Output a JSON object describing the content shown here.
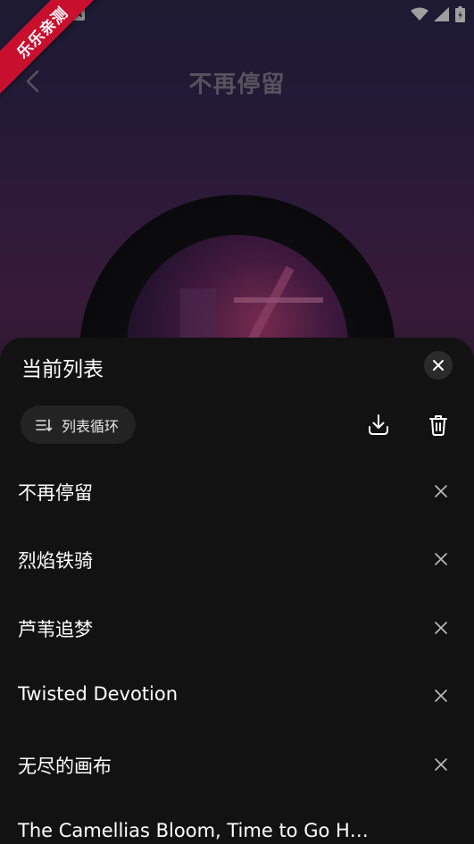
{
  "app": {
    "watermark": "乐乐亲测",
    "sim_label": "A"
  },
  "player": {
    "title": "不再停留"
  },
  "sheet": {
    "title": "当前列表",
    "play_mode": "列表循环",
    "songs": [
      {
        "name": "不再停留"
      },
      {
        "name": "烈焰铁骑"
      },
      {
        "name": "芦苇追梦"
      },
      {
        "name": "Twisted Devotion"
      },
      {
        "name": "无尽的画布"
      },
      {
        "name": "The Camellias Bloom, Time to Go Ho…"
      }
    ]
  },
  "colors": {
    "sheet_bg": "#121212",
    "ribbon": "#c8102e",
    "icon": "#d9d9d9",
    "title_muted": "#8d8697"
  },
  "icons": [
    "back-chevron-icon",
    "wifi-icon",
    "signal-icon",
    "battery-icon",
    "close-icon",
    "list-loop-icon",
    "download-icon",
    "trash-icon",
    "remove-icon"
  ]
}
